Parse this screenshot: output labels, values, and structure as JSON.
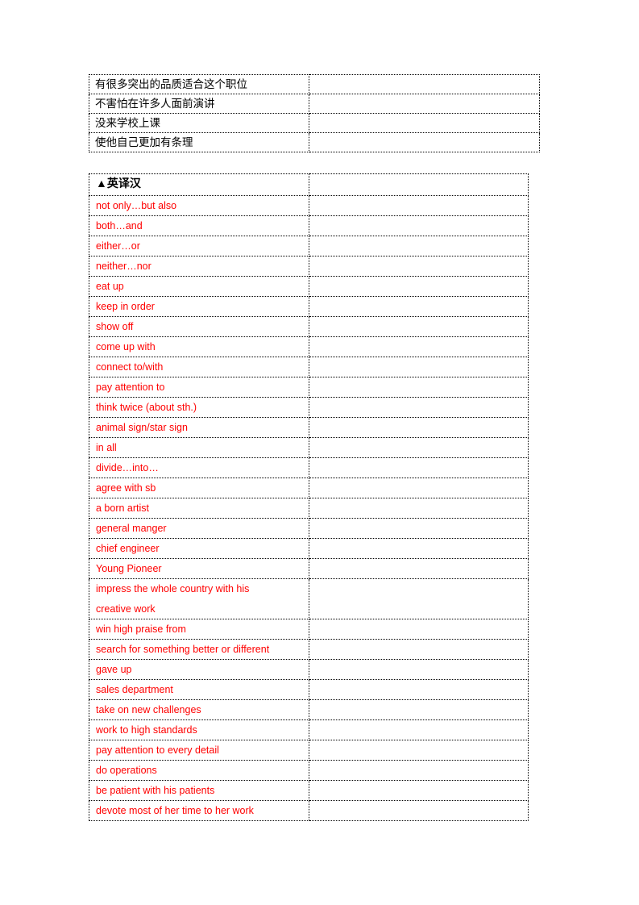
{
  "document": {
    "background_color": "#ffffff",
    "text_color_primary": "#000000",
    "text_color_accent": "#ff0000",
    "border_style": "dotted-black"
  },
  "chinese_table": {
    "column_headers": [
      "",
      ""
    ],
    "rows": [
      {
        "prompt": "有很多突出的品质适合这个职位",
        "answer": ""
      },
      {
        "prompt": "不害怕在许多人面前演讲",
        "answer": ""
      },
      {
        "prompt": "没来学校上课",
        "answer": ""
      },
      {
        "prompt": "使他自己更加有条理",
        "answer": ""
      }
    ]
  },
  "english_table": {
    "header": {
      "title": "▲英译汉",
      "answer": ""
    },
    "rows": [
      {
        "prompt": "not only…but also",
        "answer": ""
      },
      {
        "prompt": "both…and",
        "answer": ""
      },
      {
        "prompt": "either…or",
        "answer": ""
      },
      {
        "prompt": "neither…nor",
        "answer": ""
      },
      {
        "prompt": "eat up",
        "answer": ""
      },
      {
        "prompt": "keep in order",
        "answer": ""
      },
      {
        "prompt": "show off",
        "answer": ""
      },
      {
        "prompt": "come up with",
        "answer": ""
      },
      {
        "prompt": "connect to/with",
        "answer": ""
      },
      {
        "prompt": "pay attention to",
        "answer": ""
      },
      {
        "prompt": "think twice (about sth.)",
        "answer": ""
      },
      {
        "prompt": "animal sign/star sign",
        "answer": ""
      },
      {
        "prompt": "in all",
        "answer": ""
      },
      {
        "prompt": "divide…into…",
        "answer": ""
      },
      {
        "prompt": "agree with sb",
        "answer": ""
      },
      {
        "prompt": "a born artist",
        "answer": ""
      },
      {
        "prompt": "general manger",
        "answer": ""
      },
      {
        "prompt": "chief engineer",
        "answer": ""
      },
      {
        "prompt": "Young Pioneer",
        "answer": ""
      },
      {
        "prompt_line1": "impress the whole country with his",
        "prompt_line2": "creative work",
        "answer": "",
        "wrapped": true
      },
      {
        "prompt": "win high praise from",
        "answer": ""
      },
      {
        "prompt": "search for something better or different",
        "answer": ""
      },
      {
        "prompt": "gave up",
        "answer": ""
      },
      {
        "prompt": "sales department",
        "answer": ""
      },
      {
        "prompt": "take on new challenges",
        "answer": ""
      },
      {
        "prompt": "work to high standards",
        "answer": ""
      },
      {
        "prompt": "pay attention to every detail",
        "answer": ""
      },
      {
        "prompt": "do operations",
        "answer": ""
      },
      {
        "prompt": "be patient with his patients",
        "answer": ""
      },
      {
        "prompt": "devote most of her time to her work",
        "answer": ""
      }
    ]
  }
}
